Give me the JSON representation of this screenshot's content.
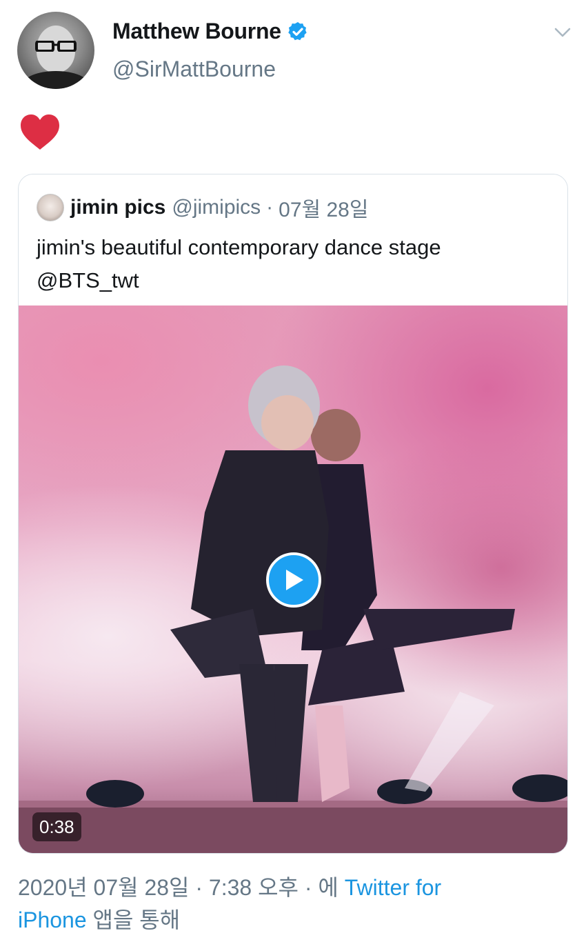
{
  "author": {
    "name": "Matthew Bourne",
    "handle": "@SirMattBourne",
    "verified": true,
    "avatar_icon": "avatar-photo"
  },
  "tweet": {
    "content_icon": "red-heart-emoji"
  },
  "quoted_tweet": {
    "name": "jimin pics",
    "handle": "@jimipics",
    "separator": "·",
    "date": "07월 28일",
    "text_line1": "jimin's beautiful contemporary dance stage",
    "text_line2": "@BTS_twt",
    "media": {
      "type": "video",
      "duration": "0:38",
      "play_icon": "play-icon"
    }
  },
  "footer": {
    "timestamp": "2020년 07월 28일 · 7:38 오후 · 에",
    "source_link_part1": "Twitter for",
    "source_link_part2": "iPhone",
    "suffix": "앱을 통해"
  },
  "colors": {
    "brand_blue": "#1da1f2",
    "link_blue": "#1b95e0",
    "secondary_text": "#657786",
    "heart_red": "#dd2e44"
  }
}
